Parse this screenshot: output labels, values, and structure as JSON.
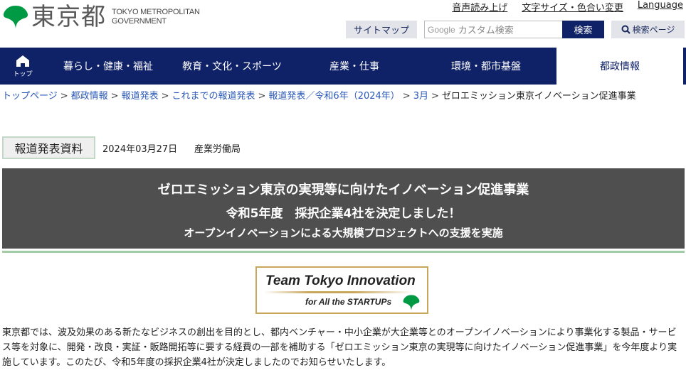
{
  "header": {
    "logo_kanji": "東京都",
    "logo_en_line1": "TOKYO METROPOLITAN",
    "logo_en_line2": "GOVERNMENT",
    "brand_green": "#009944",
    "util_links": [
      "音声読み上げ",
      "文字サイズ・色合い変更",
      "Language"
    ],
    "sitemap_label": "サイトマップ",
    "search": {
      "google_label": "Google",
      "placeholder": "カスタム検索",
      "button_label": "検索"
    },
    "search_page_label": "検索ページ"
  },
  "nav": {
    "top_label": "トップ",
    "items": [
      {
        "label": "暮らし・健康・福祉",
        "active": false
      },
      {
        "label": "教育・文化・スポーツ",
        "active": false
      },
      {
        "label": "産業・仕事",
        "active": false
      },
      {
        "label": "環境・都市基盤",
        "active": false
      },
      {
        "label": "都政情報",
        "active": true
      }
    ],
    "color": "#0f2167"
  },
  "breadcrumb": {
    "links": [
      "トップページ",
      "都政情報",
      "報道発表",
      "これまでの報道発表",
      "報道発表／令和6年（2024年）",
      "3月"
    ],
    "current": "ゼロエミッション東京イノベーション促進事業",
    "separator": ">"
  },
  "press": {
    "badge": "報道発表資料",
    "date": "2024年03月27日",
    "department": "産業労働局"
  },
  "title": {
    "line1": "ゼロエミッション東京の実現等に向けたイノベーション促進事業",
    "line2": "令和5年度　採択企業4社を決定しました！",
    "line3": "オープンイノベーションによる大規模プロジェクトへの支援を実施"
  },
  "banner": {
    "line1": "Team Tokyo Innovation",
    "line2": "for All the STARTUPs"
  },
  "body": {
    "paragraph": "東京都では、波及効果のある新たなビジネスの創出を目的とし、都内ベンチャー・中小企業が大企業等とのオープンイノベーションにより事業化する製品・サービス等を対象に、開発・改良・実証・販路開拓等に要する経費の一部を補助する「ゼロエミッション東京の実現等に向けたイノベーション促進事業」を今年度より実施しています。このたび、令和5年度の採択企業4社が決定しましたのでお知らせいたします。"
  }
}
